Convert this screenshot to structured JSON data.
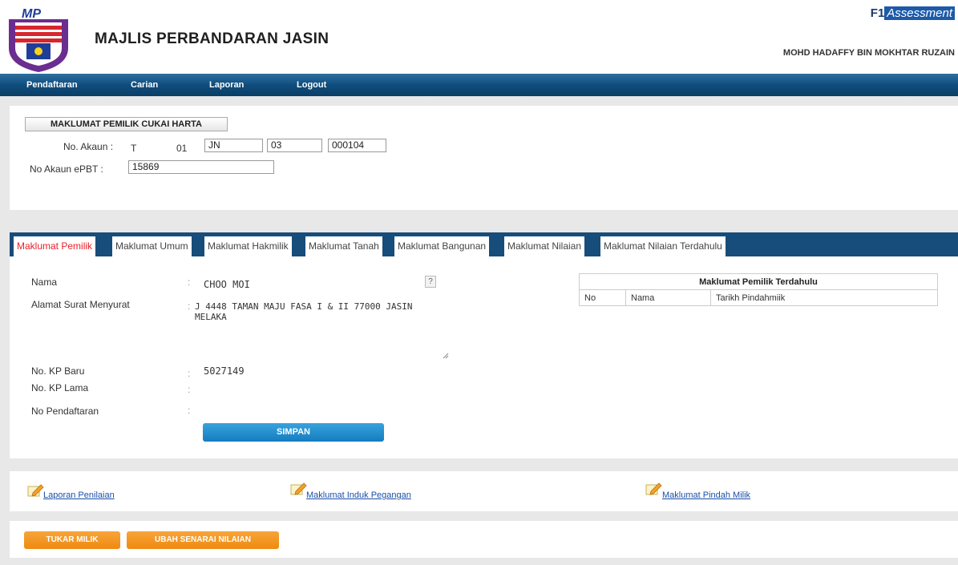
{
  "header": {
    "org_name": "MAJLIS PERBANDARAN JASIN",
    "brand_f1": "F1",
    "brand_assessment": "Assessment",
    "user_name": "MOHD HADAFFY BIN MOKHTAR RUZAIN"
  },
  "nav": {
    "items": [
      "Pendaftaran",
      "Carian",
      "Laporan",
      "Logout"
    ]
  },
  "owner_info": {
    "section_title": "MAKLUMAT PEMILIK CUKAI HARTA",
    "account_label": "No. Akaun :",
    "account_part1": "T",
    "account_part2": "01",
    "account_field1": "JN",
    "account_field2": "03",
    "account_field3": "000104",
    "epbt_label": "No Akaun ePBT :",
    "epbt_value": "15869"
  },
  "tabs": [
    "Maklumat Pemilik",
    "Maklumat Umum",
    "Maklumat Hakmilik",
    "Maklumat Tanah",
    "Maklumat Bangunan",
    "Maklumat Nilaian",
    "Maklumat Nilaian Terdahulu"
  ],
  "form": {
    "name_label": "Nama",
    "name_value": "CHOO MOI",
    "address_label": "Alamat Surat Menyurat",
    "address_line1": "J 4448 TAMAN MAJU FASA I & II 77000  JASIN",
    "address_line2": "MELAKA",
    "kp_new_label": "No. KP Baru",
    "kp_new_value": "5027149",
    "kp_old_label": "No. KP Lama",
    "kp_old_value": "",
    "reg_label": "No Pendaftaran",
    "reg_value": "",
    "colon": ":",
    "help_symbol": "?",
    "save_label": "SIMPAN"
  },
  "previous_owner": {
    "title": "Maklumat Pemilik Terdahulu",
    "columns": [
      "No",
      "Nama",
      "Tarikh Pindahmiik"
    ]
  },
  "links": [
    "Laporan Penilaian",
    "Maklumat Induk Pegangan",
    "Maklumat Pindah Milik"
  ],
  "actions": {
    "change_owner": "TUKAR MILIK",
    "change_valuation_list": "UBAH SENARAI NILAIAN"
  },
  "colors": {
    "nav_blue": "#0f4d7d",
    "tab_bar": "#174d7a",
    "active_tab": "#e8202a",
    "save_button": "#1f8fd1",
    "action_orange": "#f29a1f",
    "link_blue": "#1a4fa8"
  },
  "icons": [
    "municipal-logo",
    "pencil-note-icon",
    "help-icon",
    "resize-handle-icon"
  ]
}
